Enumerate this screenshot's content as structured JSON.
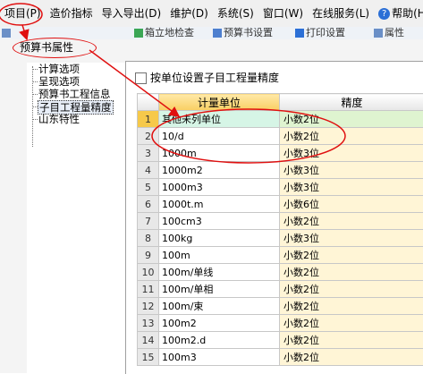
{
  "menubar": {
    "items": [
      "项目(P)",
      "造价指标",
      "导入导出(D)",
      "维护(D)",
      "系统(S)",
      "窗口(W)",
      "在线服务(L)"
    ],
    "help_icon": "question-icon",
    "help_label": "帮助(H)"
  },
  "toolbar": {
    "items": [
      "箱立地检查",
      "预算书设置",
      "打印设置",
      "属性"
    ]
  },
  "dialog": {
    "title": "预算书属性",
    "tree": [
      {
        "label": "计算选项",
        "selected": false
      },
      {
        "label": "呈现选项",
        "selected": false
      },
      {
        "label": "预算书工程信息",
        "selected": false
      },
      {
        "label": "子目工程量精度",
        "selected": true
      },
      {
        "label": "山东特性",
        "selected": false
      }
    ],
    "checkbox_label": "按单位设置子目工程量精度",
    "checkbox_checked": false,
    "grid": {
      "columns": [
        "",
        "计量单位",
        "精度"
      ],
      "rows": [
        {
          "no": "1",
          "unit": "其他未列单位",
          "precision": "小数2位",
          "selected": true
        },
        {
          "no": "2",
          "unit": "10/d",
          "precision": "小数2位"
        },
        {
          "no": "3",
          "unit": "1000m",
          "precision": "小数3位"
        },
        {
          "no": "4",
          "unit": "1000m2",
          "precision": "小数3位"
        },
        {
          "no": "5",
          "unit": "1000m3",
          "precision": "小数3位"
        },
        {
          "no": "6",
          "unit": "1000t.m",
          "precision": "小数6位"
        },
        {
          "no": "7",
          "unit": "100cm3",
          "precision": "小数2位"
        },
        {
          "no": "8",
          "unit": "100kg",
          "precision": "小数3位"
        },
        {
          "no": "9",
          "unit": "100m",
          "precision": "小数2位"
        },
        {
          "no": "10",
          "unit": "100m/单线",
          "precision": "小数2位"
        },
        {
          "no": "11",
          "unit": "100m/单相",
          "precision": "小数2位"
        },
        {
          "no": "12",
          "unit": "100m/束",
          "precision": "小数2位"
        },
        {
          "no": "13",
          "unit": "100m2",
          "precision": "小数2位"
        },
        {
          "no": "14",
          "unit": "100m2.d",
          "precision": "小数2位"
        },
        {
          "no": "15",
          "unit": "100m3",
          "precision": "小数2位"
        }
      ]
    }
  },
  "colors": {
    "annotation_red": "#e01010",
    "header_accent": "#f9cf63",
    "selected_row": "#d6f5e6"
  }
}
